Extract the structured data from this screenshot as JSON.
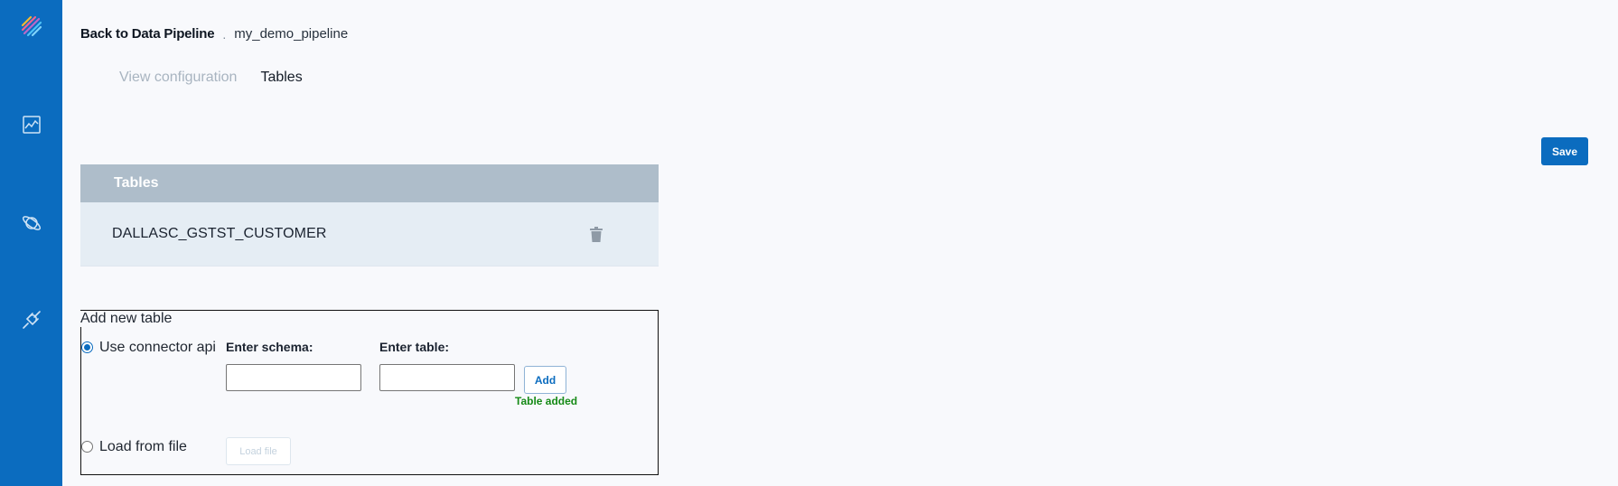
{
  "sidebar": {
    "items": [
      {
        "icon": "logo-icon"
      },
      {
        "icon": "chart-icon"
      },
      {
        "icon": "planet-icon"
      },
      {
        "icon": "plug-icon"
      }
    ],
    "color": "#0b6cbf"
  },
  "breadcrumb": {
    "back_label": "Back to Data Pipeline",
    "separator": ".",
    "current": "my_demo_pipeline"
  },
  "tabs": [
    {
      "label": "View configuration",
      "active": false
    },
    {
      "label": "Tables",
      "active": true
    }
  ],
  "toolbar": {
    "save_label": "Save"
  },
  "tables_panel": {
    "header": "Tables",
    "rows": [
      {
        "name": "DALLASC_GSTST_CUSTOMER",
        "action_icon": "trash-icon"
      }
    ]
  },
  "add_table": {
    "legend": "Add new table",
    "option_api": {
      "label": "Use connector api",
      "checked": true
    },
    "schema": {
      "label": "Enter schema:",
      "value": "",
      "placeholder": ""
    },
    "table": {
      "label": "Enter table:",
      "value": "",
      "placeholder": ""
    },
    "add_label": "Add",
    "status": "Table added",
    "option_file": {
      "label": "Load from file",
      "checked": false
    },
    "load_label": "Load file"
  },
  "colors": {
    "accent": "#0b6cbf",
    "panel_header": "#aebdca",
    "row_bg": "#e5edf4",
    "success": "#168a16"
  }
}
